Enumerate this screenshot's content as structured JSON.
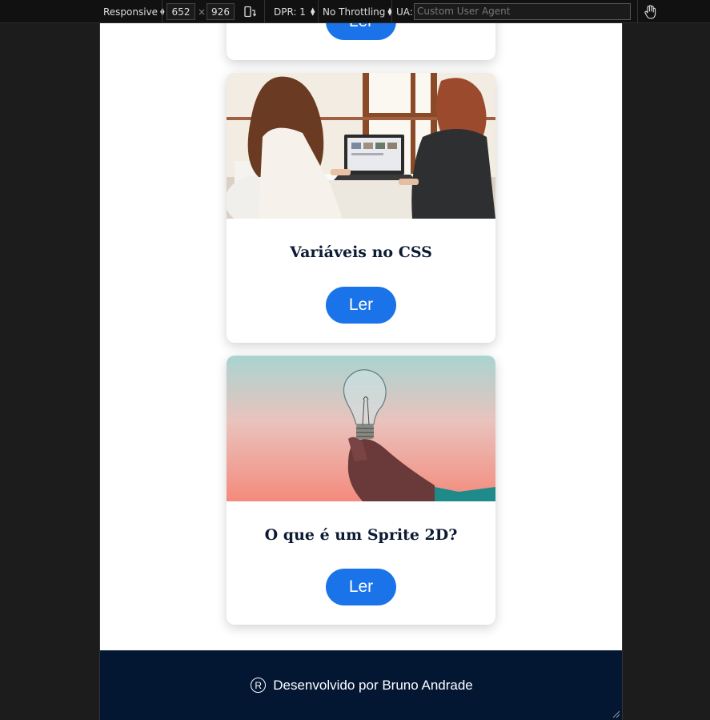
{
  "devtools": {
    "mode_label": "Responsive",
    "width": "652",
    "times": "×",
    "height": "926",
    "dpr_label": "DPR: 1",
    "throttling_label": "No Throttling",
    "ua_label": "UA:",
    "ua_placeholder": "Custom User Agent"
  },
  "cards": [
    {
      "title": "",
      "button_label": "Ler"
    },
    {
      "title": "Variáveis no CSS",
      "button_label": "Ler",
      "image": "women-at-laptop-photo"
    },
    {
      "title": "O que é um Sprite 2D?",
      "button_label": "Ler",
      "image": "hand-holding-lightbulb-photo"
    }
  ],
  "footer": {
    "symbol": "R",
    "text": "Desenvolvido por Bruno Andrade"
  },
  "colors": {
    "accent": "#1a73e8",
    "footer_bg": "#031733",
    "title": "#0c1b33"
  }
}
